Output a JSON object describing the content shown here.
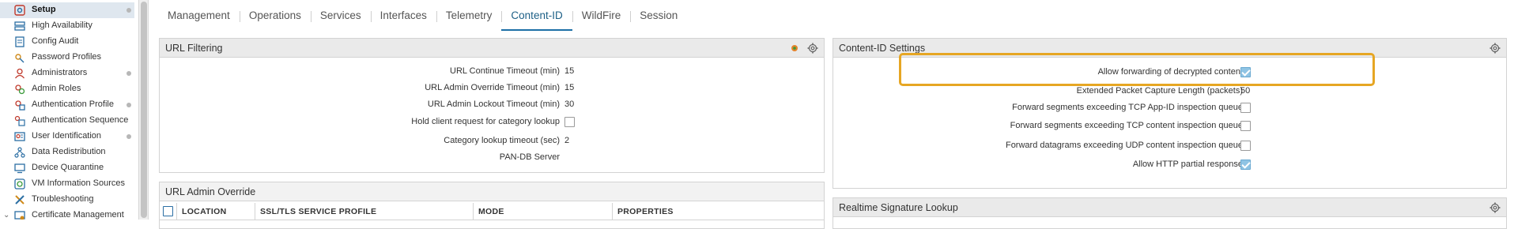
{
  "sidebar": {
    "items": [
      {
        "label": "Setup",
        "icon": "setup-icon",
        "active": true,
        "dot": true
      },
      {
        "label": "High Availability",
        "icon": "high-availability-icon",
        "active": false,
        "dot": false
      },
      {
        "label": "Config Audit",
        "icon": "config-audit-icon",
        "active": false,
        "dot": false
      },
      {
        "label": "Password Profiles",
        "icon": "password-profiles-icon",
        "active": false,
        "dot": false
      },
      {
        "label": "Administrators",
        "icon": "administrators-icon",
        "active": false,
        "dot": true
      },
      {
        "label": "Admin Roles",
        "icon": "admin-roles-icon",
        "active": false,
        "dot": false
      },
      {
        "label": "Authentication Profile",
        "icon": "authentication-profile-icon",
        "active": false,
        "dot": true
      },
      {
        "label": "Authentication Sequence",
        "icon": "authentication-sequence-icon",
        "active": false,
        "dot": false
      },
      {
        "label": "User Identification",
        "icon": "user-identification-icon",
        "active": false,
        "dot": true
      },
      {
        "label": "Data Redistribution",
        "icon": "data-redistribution-icon",
        "active": false,
        "dot": false
      },
      {
        "label": "Device Quarantine",
        "icon": "device-quarantine-icon",
        "active": false,
        "dot": false
      },
      {
        "label": "VM Information Sources",
        "icon": "vm-information-sources-icon",
        "active": false,
        "dot": false
      },
      {
        "label": "Troubleshooting",
        "icon": "troubleshooting-icon",
        "active": false,
        "dot": false
      },
      {
        "label": "Certificate Management",
        "icon": "certificate-management-icon",
        "active": false,
        "dot": false
      }
    ]
  },
  "tabs": [
    {
      "label": "Management",
      "active": false
    },
    {
      "label": "Operations",
      "active": false
    },
    {
      "label": "Services",
      "active": false
    },
    {
      "label": "Interfaces",
      "active": false
    },
    {
      "label": "Telemetry",
      "active": false
    },
    {
      "label": "Content-ID",
      "active": true
    },
    {
      "label": "WildFire",
      "active": false
    },
    {
      "label": "Session",
      "active": false
    }
  ],
  "url_filtering": {
    "title": "URL Filtering",
    "rows": [
      {
        "label": "URL Continue Timeout (min)",
        "value": "15"
      },
      {
        "label": "URL Admin Override Timeout (min)",
        "value": "15"
      },
      {
        "label": "URL Admin Lockout Timeout (min)",
        "value": "30"
      },
      {
        "label": "Hold client request for category lookup",
        "checkbox": false
      },
      {
        "label": "Category lookup timeout (sec)",
        "value": "2"
      },
      {
        "label": "PAN-DB Server",
        "value": ""
      }
    ]
  },
  "url_admin_override": {
    "title": "URL Admin Override",
    "columns": [
      "LOCATION",
      "SSL/TLS SERVICE PROFILE",
      "MODE",
      "PROPERTIES"
    ]
  },
  "content_id_settings": {
    "title": "Content-ID Settings",
    "rows": [
      {
        "label": "Allow forwarding of decrypted content",
        "checkbox": true
      },
      {
        "label": "Extended Packet Capture Length (packets)",
        "value": "50"
      },
      {
        "label": "Forward segments exceeding TCP App-ID inspection queue",
        "checkbox": false
      },
      {
        "label": "Forward segments exceeding TCP content inspection queue",
        "checkbox": false
      },
      {
        "label": "Forward datagrams exceeding UDP content inspection queue",
        "checkbox": false
      },
      {
        "label": "Allow HTTP partial response",
        "checkbox": true
      }
    ]
  },
  "realtime_signature_lookup": {
    "title": "Realtime Signature Lookup"
  },
  "colors": {
    "accent": "#1c6fa6",
    "highlight": "#e6a623",
    "checked": "#8fc4e4"
  }
}
